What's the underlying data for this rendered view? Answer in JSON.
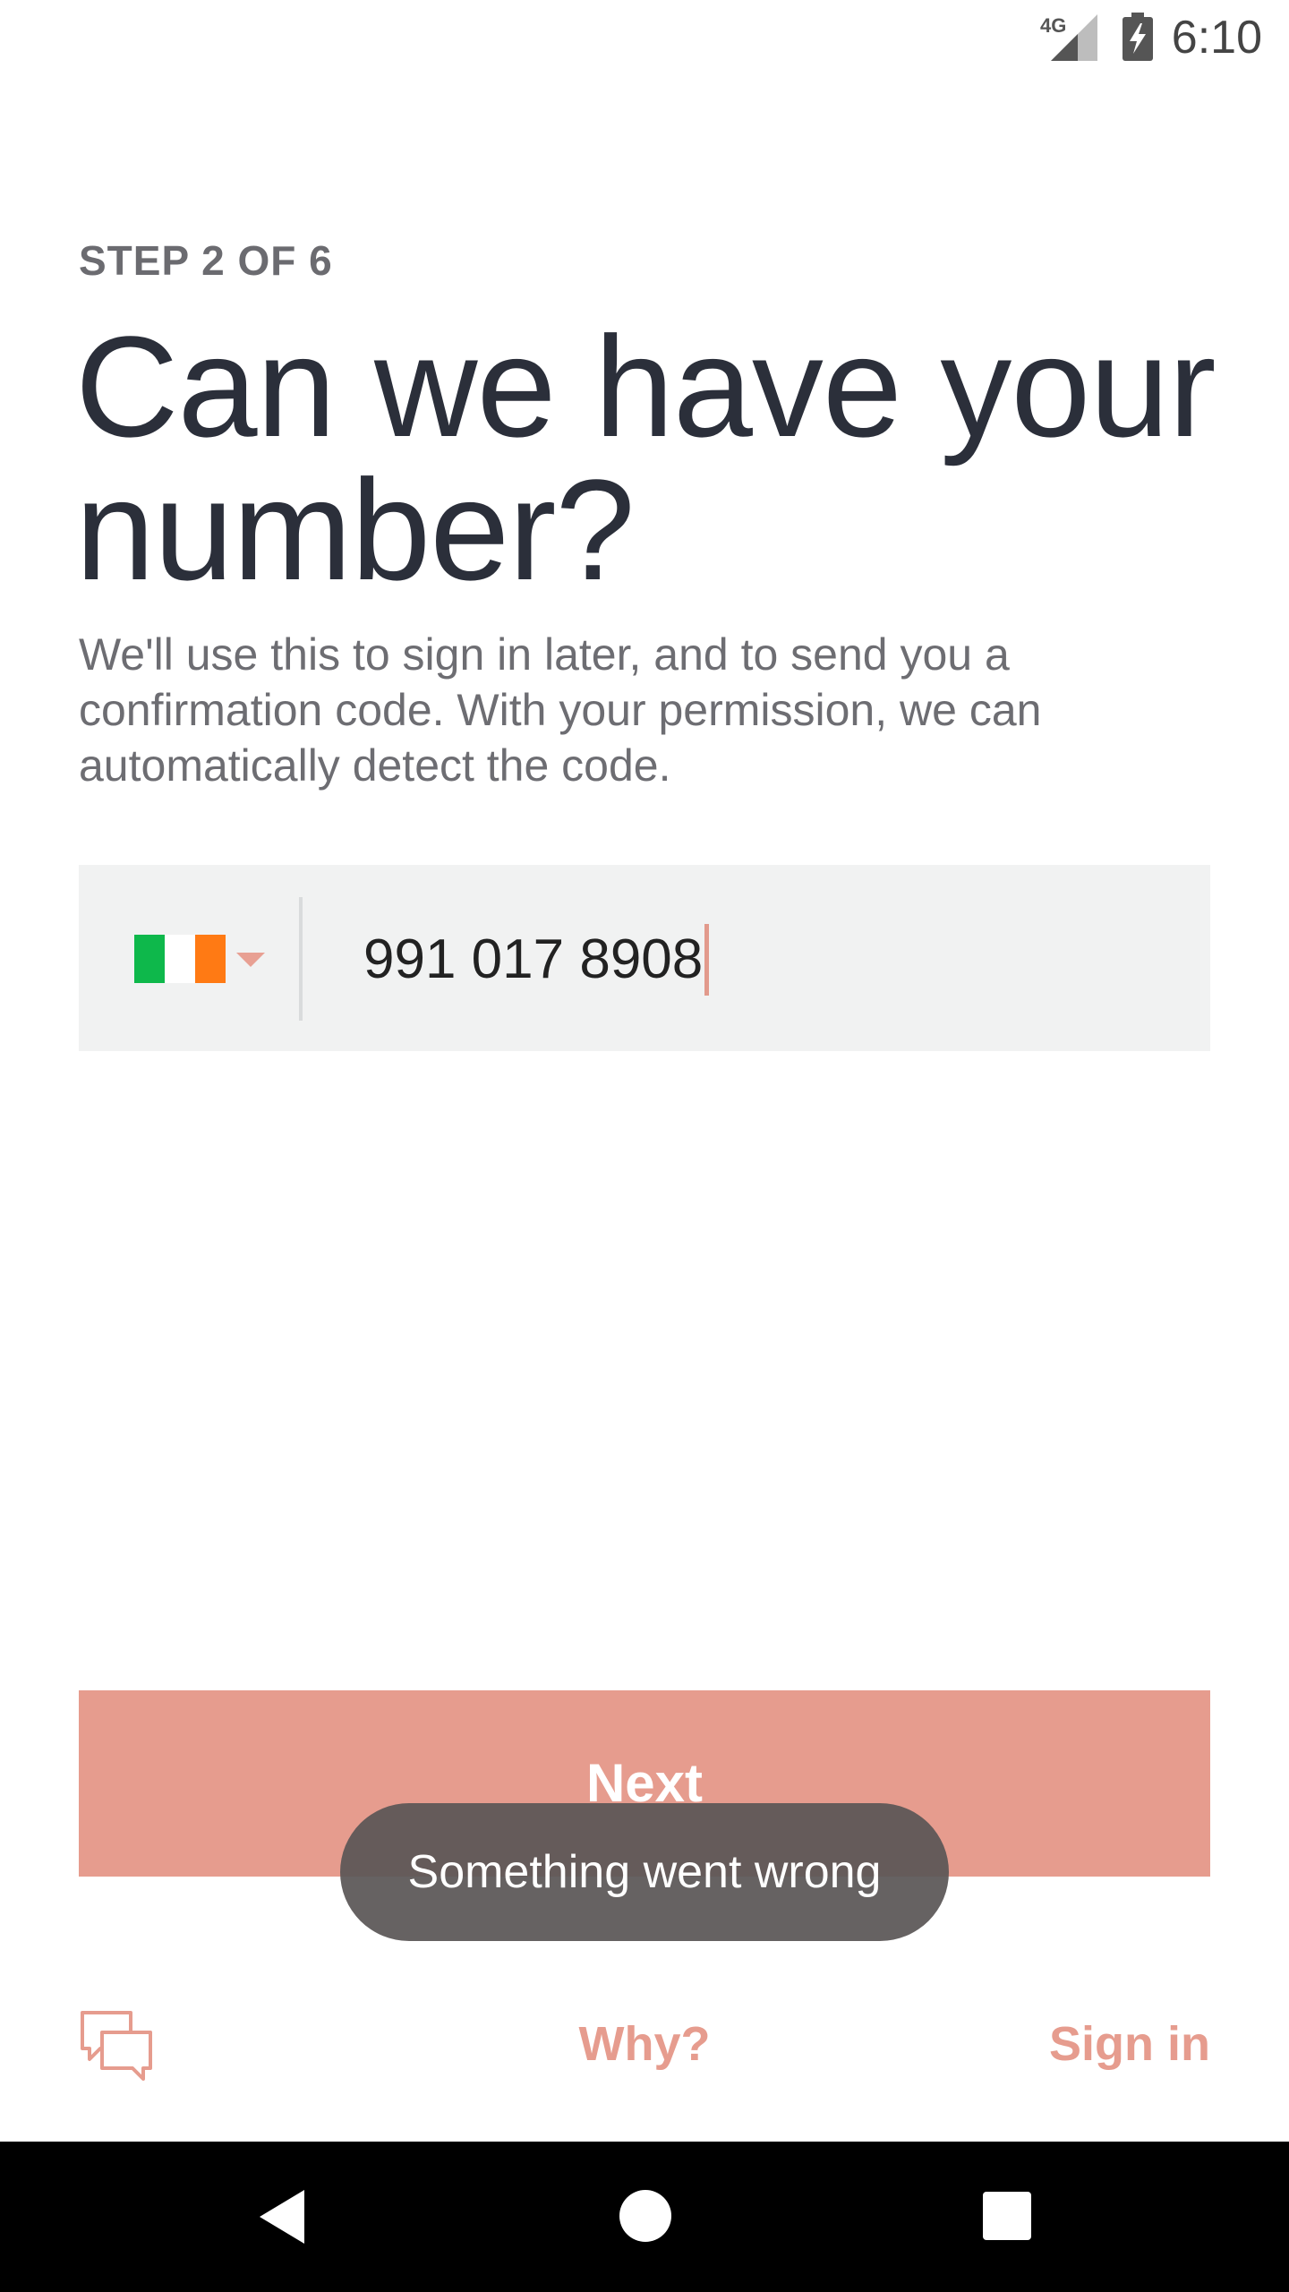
{
  "status_bar": {
    "network_label": "4G",
    "time": "6:10",
    "icons": [
      "signal-icon",
      "battery-charging-icon"
    ]
  },
  "onboarding": {
    "step_label": "STEP 2 OF 6",
    "title": "Can we have your number?",
    "description": "We'll use this to sign in later, and to send you a confirmation code. With your permission, we can automatically detect the code."
  },
  "phone_field": {
    "country_flag": "flag-icon-ireland",
    "value": "991 017 8908"
  },
  "buttons": {
    "next_label": "Next"
  },
  "toast": {
    "message": "Something went wrong"
  },
  "footer": {
    "chat_icon": "chat-icon",
    "why_label": "Why?",
    "signin_label": "Sign in"
  },
  "nav_bar": {
    "icons": [
      "back-icon",
      "home-icon",
      "recents-icon"
    ]
  },
  "colors": {
    "accent": "#e69c8e",
    "title_text": "#2b2f3a",
    "body_text": "#6d6d72",
    "field_background": "#f1f2f2",
    "flag_green": "#0eb84b",
    "flag_orange": "#ff7a14",
    "toast_background": "#5a5656"
  }
}
